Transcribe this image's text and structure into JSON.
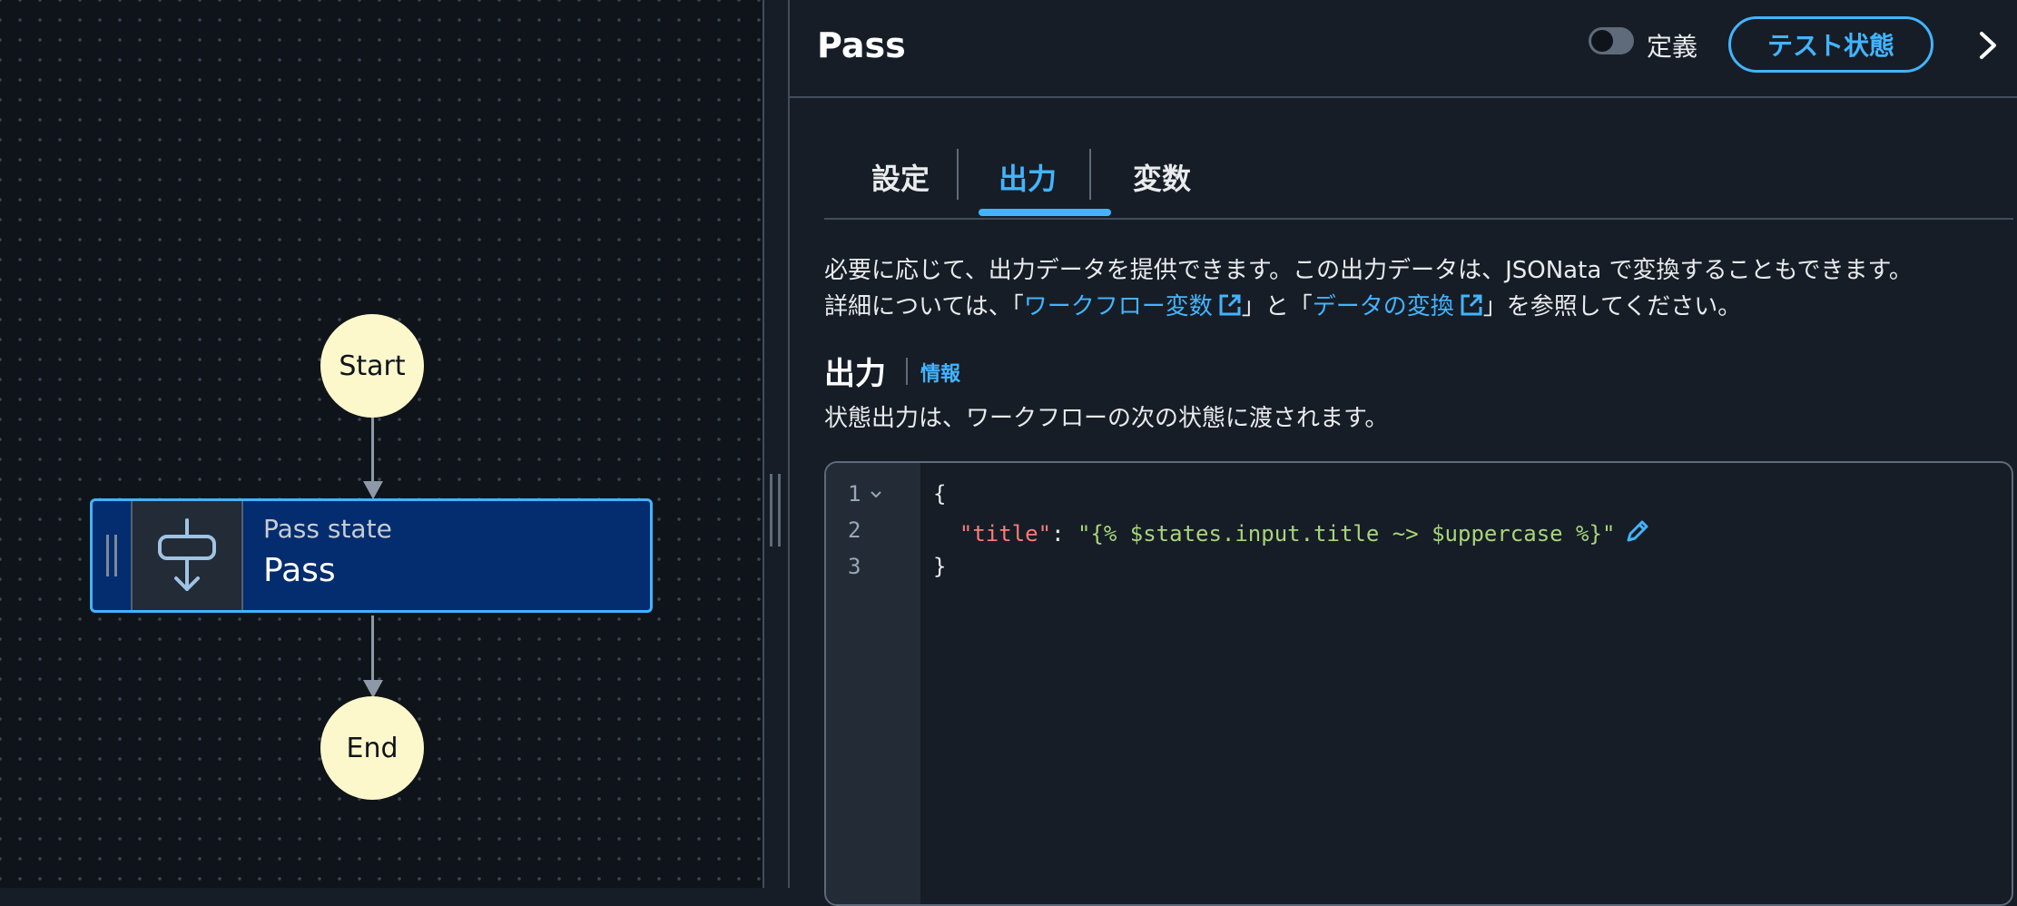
{
  "canvas": {
    "start_label": "Start",
    "end_label": "End",
    "pass_node": {
      "type_label": "Pass state",
      "name": "Pass"
    }
  },
  "panel": {
    "title": "Pass",
    "definition_toggle_label": "定義",
    "test_button_label": "テスト状態",
    "tabs": [
      {
        "label": "設定"
      },
      {
        "label": "出力"
      },
      {
        "label": "変数"
      }
    ],
    "active_tab": "出力",
    "description": {
      "line1": "必要に応じて、出力データを提供できます。この出力データは、JSONata で変換することもできます。",
      "line2_prefix": "詳細については、「",
      "link1": "ワークフロー変数",
      "line2_mid": "」と「",
      "link2": "データの変換",
      "line2_suffix": "」を参照してください。"
    },
    "output_heading": "出力",
    "info_link": "情報",
    "output_description": "状態出力は、ワークフローの次の状態に渡されます。",
    "editor": {
      "line_numbers": [
        "1",
        "2",
        "3"
      ],
      "line1": "{",
      "line2_indent": "  ",
      "line2_key": "\"title\"",
      "line2_colon": ": ",
      "line2_value": "\"{% $states.input.title ~> $uppercase %}\"",
      "line3": "}"
    }
  },
  "colors": {
    "accent": "#42b4ff",
    "node_fill": "#fdf8cc",
    "selected_node": "#032d6e"
  }
}
